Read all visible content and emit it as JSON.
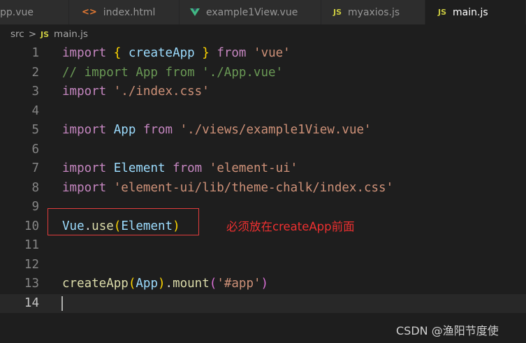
{
  "tabs": [
    {
      "label": "pp.vue",
      "icon": "none"
    },
    {
      "label": "index.html",
      "icon": "html-icon",
      "icon_text": "<>"
    },
    {
      "label": "example1View.vue",
      "icon": "vue-icon"
    },
    {
      "label": "myaxios.js",
      "icon": "js-icon",
      "icon_text": "JS"
    },
    {
      "label": "main.js",
      "icon": "js-icon",
      "icon_text": "JS",
      "active": true
    }
  ],
  "breadcrumb": {
    "folder": "src",
    "separator": ">",
    "file_icon": "JS",
    "file": "main.js"
  },
  "editor": {
    "current_line": 14,
    "lines": [
      {
        "n": "1",
        "tokens": [
          [
            "kw",
            "import"
          ],
          [
            "pl",
            " "
          ],
          [
            "br",
            "{"
          ],
          [
            "pl",
            " "
          ],
          [
            "id",
            "createApp"
          ],
          [
            "pl",
            " "
          ],
          [
            "br",
            "}"
          ],
          [
            "pl",
            " "
          ],
          [
            "kw",
            "from"
          ],
          [
            "pl",
            " "
          ],
          [
            "str",
            "'vue'"
          ]
        ]
      },
      {
        "n": "2",
        "tokens": [
          [
            "cm",
            "// import App from './App.vue'"
          ]
        ]
      },
      {
        "n": "3",
        "tokens": [
          [
            "kw",
            "import"
          ],
          [
            "pl",
            " "
          ],
          [
            "str",
            "'./index.css'"
          ]
        ]
      },
      {
        "n": "4",
        "tokens": []
      },
      {
        "n": "5",
        "tokens": [
          [
            "kw",
            "import"
          ],
          [
            "pl",
            " "
          ],
          [
            "id",
            "App"
          ],
          [
            "pl",
            " "
          ],
          [
            "kw",
            "from"
          ],
          [
            "pl",
            " "
          ],
          [
            "str",
            "'./views/example1View.vue'"
          ]
        ]
      },
      {
        "n": "6",
        "tokens": []
      },
      {
        "n": "7",
        "tokens": [
          [
            "kw",
            "import"
          ],
          [
            "pl",
            " "
          ],
          [
            "id",
            "Element"
          ],
          [
            "pl",
            " "
          ],
          [
            "kw",
            "from"
          ],
          [
            "pl",
            " "
          ],
          [
            "str",
            "'element-ui'"
          ]
        ]
      },
      {
        "n": "8",
        "tokens": [
          [
            "kw",
            "import"
          ],
          [
            "pl",
            " "
          ],
          [
            "str",
            "'element-ui/lib/theme-chalk/index.css'"
          ]
        ]
      },
      {
        "n": "9",
        "tokens": []
      },
      {
        "n": "10",
        "tokens": [
          [
            "id",
            "Vue"
          ],
          [
            "pl",
            "."
          ],
          [
            "fn",
            "use"
          ],
          [
            "br",
            "("
          ],
          [
            "id",
            "Element"
          ],
          [
            "br",
            ")"
          ]
        ]
      },
      {
        "n": "11",
        "tokens": []
      },
      {
        "n": "12",
        "tokens": []
      },
      {
        "n": "13",
        "tokens": [
          [
            "fn",
            "createApp"
          ],
          [
            "br",
            "("
          ],
          [
            "id",
            "App"
          ],
          [
            "br",
            ")"
          ],
          [
            "pl",
            "."
          ],
          [
            "fn",
            "mount"
          ],
          [
            "br2",
            "("
          ],
          [
            "str",
            "'#app'"
          ],
          [
            "br2",
            ")"
          ]
        ]
      },
      {
        "n": "14",
        "tokens": []
      }
    ]
  },
  "annotation": {
    "text": "必须放在createApp前面",
    "color": "#ee3030"
  },
  "watermark": "CSDN @渔阳节度使"
}
